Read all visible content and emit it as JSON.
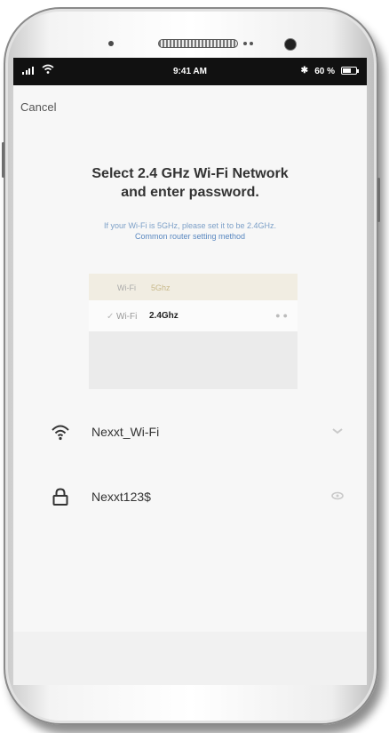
{
  "status_bar": {
    "time": "9:41 AM",
    "battery": "60 %"
  },
  "nav": {
    "cancel_label": "Cancel"
  },
  "content": {
    "title_line1": "Select 2.4 GHz Wi-Fi Network",
    "title_line2": "and enter password.",
    "hint_line1": "If your Wi-Fi is 5GHz, please set it to be 2.4GHz.",
    "hint_line2": "Common router setting method"
  },
  "illustration": {
    "row1_label": "Wi-Fi",
    "row1_band": "5Ghz",
    "row2_label": "Wi-Fi",
    "row2_band": "2.4Ghz"
  },
  "form": {
    "network_name": "Nexxt_Wi-Fi",
    "password": "Nexxt123$"
  },
  "colors": {
    "status_bar": "#111111",
    "link": "#5a88c0",
    "screen_bg": "#f7f7f7"
  },
  "icons": {
    "network_field": "wifi-icon",
    "password_field": "lock-icon",
    "network_trailing": "chevron-icon",
    "password_trailing": "eye-icon"
  }
}
